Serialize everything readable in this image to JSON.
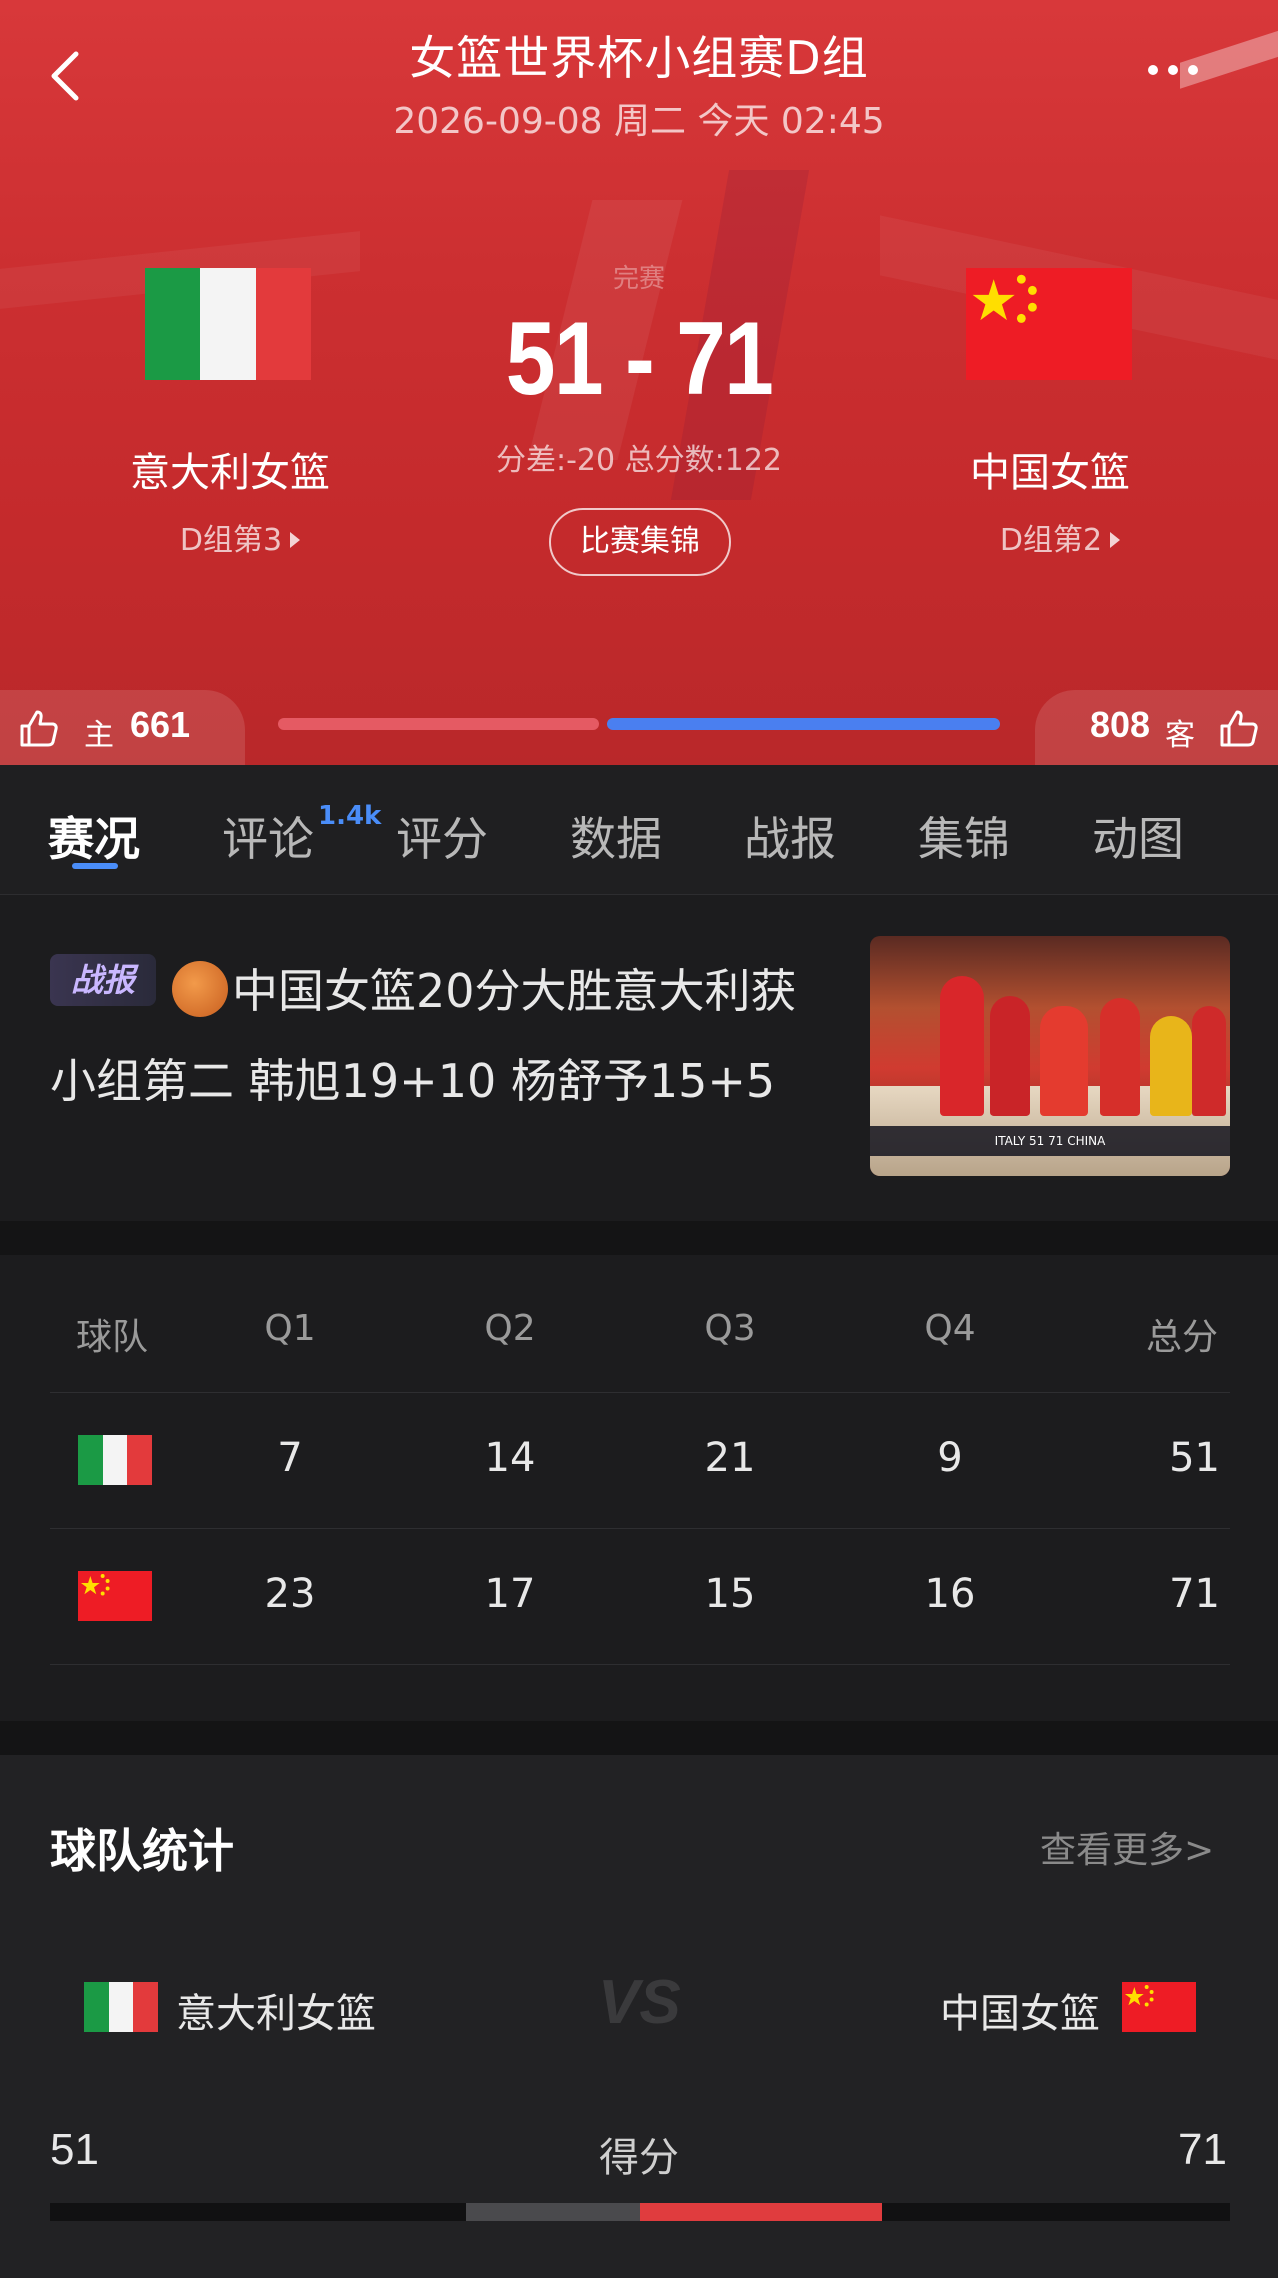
{
  "header": {
    "title": "女篮世界杯小组赛D组",
    "subtitle": "2026-09-08 周二 今天 02:45",
    "status_faint": "完赛"
  },
  "home": {
    "name": "意大利女篮",
    "rank": "D组第3",
    "support_label": "主",
    "support_count": "661"
  },
  "away": {
    "name": "中国女篮",
    "rank": "D组第2",
    "support_label": "客",
    "support_count": "808"
  },
  "score": {
    "display": "51 - 71",
    "meta": "分差:-20 总分数:122",
    "highlight_button": "比赛集锦"
  },
  "support_ratio": {
    "home": 661,
    "away": 808
  },
  "tabs": [
    {
      "label": "赛况",
      "active": true
    },
    {
      "label": "评论",
      "badge": "1.4k"
    },
    {
      "label": "评分"
    },
    {
      "label": "数据"
    },
    {
      "label": "战报"
    },
    {
      "label": "集锦"
    },
    {
      "label": "动图"
    }
  ],
  "news": {
    "tag": "战报",
    "headline": "中国女篮20分大胜意大利获小组第二 韩旭19+10 杨舒予15+5",
    "thumb_caption": "ITALY 51 71 CHINA"
  },
  "score_table": {
    "headers": [
      "球队",
      "Q1",
      "Q2",
      "Q3",
      "Q4",
      "总分"
    ],
    "rows": [
      {
        "team": "italy",
        "q": [
          "7",
          "14",
          "21",
          "9"
        ],
        "total": "51"
      },
      {
        "team": "china",
        "q": [
          "23",
          "17",
          "15",
          "16"
        ],
        "total": "71"
      }
    ]
  },
  "team_stats": {
    "title": "球队统计",
    "more": "查看更多>",
    "home_name": "意大利女篮",
    "away_name": "中国女篮",
    "vs": "VS",
    "stats": [
      {
        "name": "得分",
        "home": "51",
        "away": "71"
      }
    ]
  },
  "colors": {
    "header_red": "#cc2f31",
    "accent_blue": "#4a8df8",
    "home_bar": "#e55a63",
    "away_bar": "#4a7ff0",
    "stat_away": "#e03c3e"
  },
  "icons": [
    "back-arrow-icon",
    "more-dots-icon",
    "thumbs-up-icon",
    "basketball-icon",
    "vs-icon"
  ]
}
